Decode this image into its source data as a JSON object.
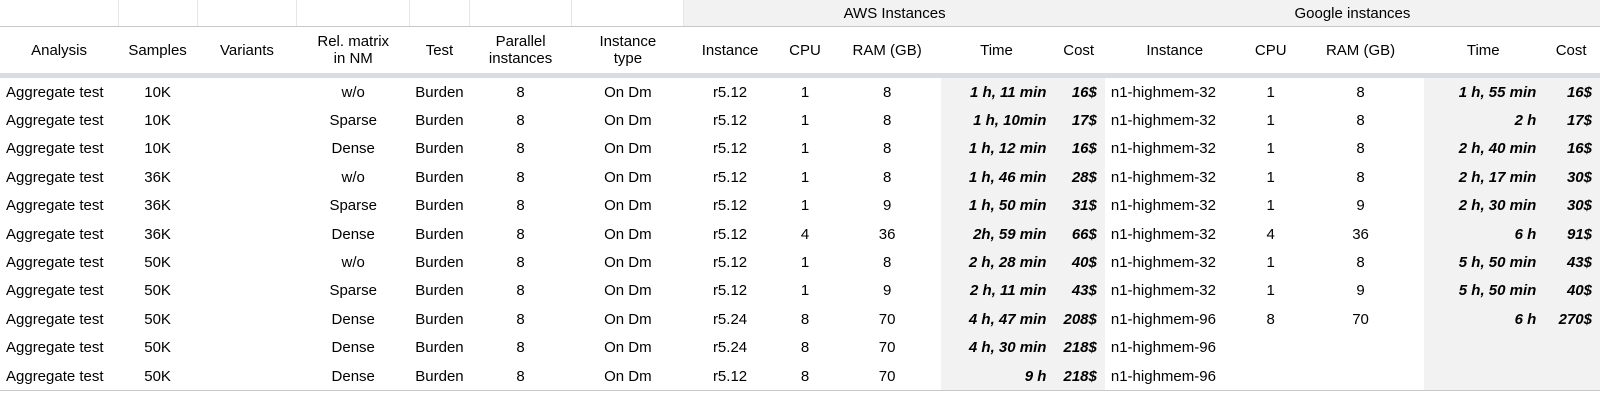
{
  "groups": {
    "aws": "AWS Instances",
    "google": "Google instances"
  },
  "columns": {
    "analysis": "Analysis",
    "samples": "Samples",
    "variants": "Variants",
    "rel_matrix_1": "Rel. matrix",
    "rel_matrix_2": "in NM",
    "test": "Test",
    "parallel_1": "Parallel",
    "parallel_2": "instances",
    "itype_1": "Instance",
    "itype_2": "type",
    "aws_instance": "Instance",
    "aws_cpu": "CPU",
    "aws_ram": "RAM (GB)",
    "aws_time": "Time",
    "aws_cost": "Cost",
    "g_instance": "Instance",
    "g_cpu": "CPU",
    "g_ram": "RAM (GB)",
    "g_time": "Time",
    "g_cost": "Cost"
  },
  "rows": [
    [
      "Aggregate test",
      "10K",
      "",
      "w/o",
      "Burden",
      "8",
      "On Dm",
      "r5.12",
      "1",
      "8",
      "1 h, 11 min",
      "16$",
      "n1-highmem-32",
      "1",
      "8",
      "1 h, 55 min",
      "16$"
    ],
    [
      "Aggregate test",
      "10K",
      "",
      "Sparse",
      "Burden",
      "8",
      "On Dm",
      "r5.12",
      "1",
      "8",
      "1 h, 10min",
      "17$",
      "n1-highmem-32",
      "1",
      "8",
      "2 h",
      "17$"
    ],
    [
      "Aggregate test",
      "10K",
      "",
      "Dense",
      "Burden",
      "8",
      "On Dm",
      "r5.12",
      "1",
      "8",
      "1 h, 12 min",
      "16$",
      "n1-highmem-32",
      "1",
      "8",
      "2 h, 40 min",
      "16$"
    ],
    [
      "Aggregate test",
      "36K",
      "",
      "w/o",
      "Burden",
      "8",
      "On Dm",
      "r5.12",
      "1",
      "8",
      "1 h, 46 min",
      "28$",
      "n1-highmem-32",
      "1",
      "8",
      "2 h, 17 min",
      "30$"
    ],
    [
      "Aggregate test",
      "36K",
      "",
      "Sparse",
      "Burden",
      "8",
      "On Dm",
      "r5.12",
      "1",
      "9",
      "1 h, 50 min",
      "31$",
      "n1-highmem-32",
      "1",
      "9",
      "2 h, 30 min",
      "30$"
    ],
    [
      "Aggregate test",
      "36K",
      "",
      "Dense",
      "Burden",
      "8",
      "On Dm",
      "r5.12",
      "4",
      "36",
      "2h, 59 min",
      "66$",
      "n1-highmem-32",
      "4",
      "36",
      "6 h",
      "91$"
    ],
    [
      "Aggregate test",
      "50K",
      "",
      "w/o",
      "Burden",
      "8",
      "On Dm",
      "r5.12",
      "1",
      "8",
      "2 h, 28 min",
      "40$",
      "n1-highmem-32",
      "1",
      "8",
      "5 h, 50 min",
      "43$"
    ],
    [
      "Aggregate test",
      "50K",
      "",
      "Sparse",
      "Burden",
      "8",
      "On Dm",
      "r5.12",
      "1",
      "9",
      "2 h, 11 min",
      "43$",
      "n1-highmem-32",
      "1",
      "9",
      "5 h, 50 min",
      "40$"
    ],
    [
      "Aggregate test",
      "50K",
      "",
      "Dense",
      "Burden",
      "8",
      "On Dm",
      "r5.24",
      "8",
      "70",
      "4 h, 47 min",
      "208$",
      "n1-highmem-96",
      "8",
      "70",
      "6 h",
      "270$"
    ],
    [
      "Aggregate test",
      "50K",
      "",
      "Dense",
      "Burden",
      "8",
      "On Dm",
      "r5.24",
      "8",
      "70",
      "4 h, 30 min",
      "218$",
      "n1-highmem-96",
      "",
      "",
      "",
      ""
    ],
    [
      "Aggregate test",
      "50K",
      "",
      "Dense",
      "Burden",
      "8",
      "On Dm",
      "r5.12",
      "8",
      "70",
      "9 h",
      "218$",
      "n1-highmem-96",
      "",
      "",
      "",
      ""
    ]
  ]
}
